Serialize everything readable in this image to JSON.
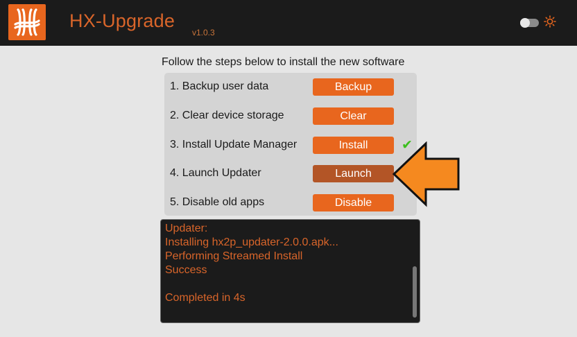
{
  "header": {
    "app_title": "HX-Upgrade",
    "version": "v1.0.3",
    "logo_icon": "hx-logo-icon",
    "theme_icon": "sun-icon",
    "accent_color": "#e8661e"
  },
  "main": {
    "instructions": "Follow the steps below to install the new software",
    "steps": [
      {
        "label": "1. Backup user data",
        "button": "Backup"
      },
      {
        "label": "2. Clear device storage",
        "button": "Clear"
      },
      {
        "label": "3. Install Update Manager",
        "button": "Install"
      },
      {
        "label": "4. Launch Updater",
        "button": "Launch"
      },
      {
        "label": "5. Disable old apps",
        "button": "Disable"
      }
    ],
    "check_mark": "✔",
    "completed_step_icon": "check-icon",
    "pointer_icon": "arrow-left-icon"
  },
  "log": {
    "lines": [
      "Updater:",
      "Installing hx2p_updater-2.0.0.apk...",
      "Performing Streamed Install",
      "Success",
      "",
      "Completed in 4s"
    ]
  }
}
